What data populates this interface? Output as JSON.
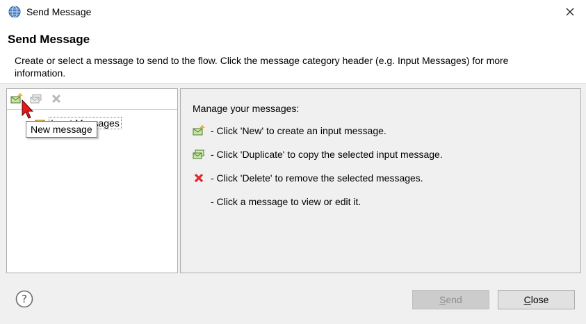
{
  "window": {
    "title": "Send Message"
  },
  "header": {
    "heading": "Send Message",
    "description": "Create or select a message to send to the flow. Click the message category header (e.g. Input Messages) for more information."
  },
  "tree": {
    "items": [
      {
        "label": "Input Messages"
      }
    ]
  },
  "tooltip": {
    "text": "New message"
  },
  "info": {
    "title": "Manage your messages:",
    "lines": [
      {
        "icon": "new-message-icon",
        "text": "- Click 'New' to create an input message."
      },
      {
        "icon": "duplicate-message-icon",
        "text": "- Click 'Duplicate' to copy the selected input message."
      },
      {
        "icon": "delete-icon",
        "text": "- Click 'Delete' to remove the selected messages."
      },
      {
        "icon": "",
        "text": "- Click a message to view or edit it."
      }
    ]
  },
  "buttons": {
    "send_rest": "end",
    "send_mnemonic": "S",
    "close_rest": "lose",
    "close_mnemonic": "C"
  },
  "colors": {
    "delete_red": "#e0262d",
    "cursor_red": "#e81b1b"
  }
}
